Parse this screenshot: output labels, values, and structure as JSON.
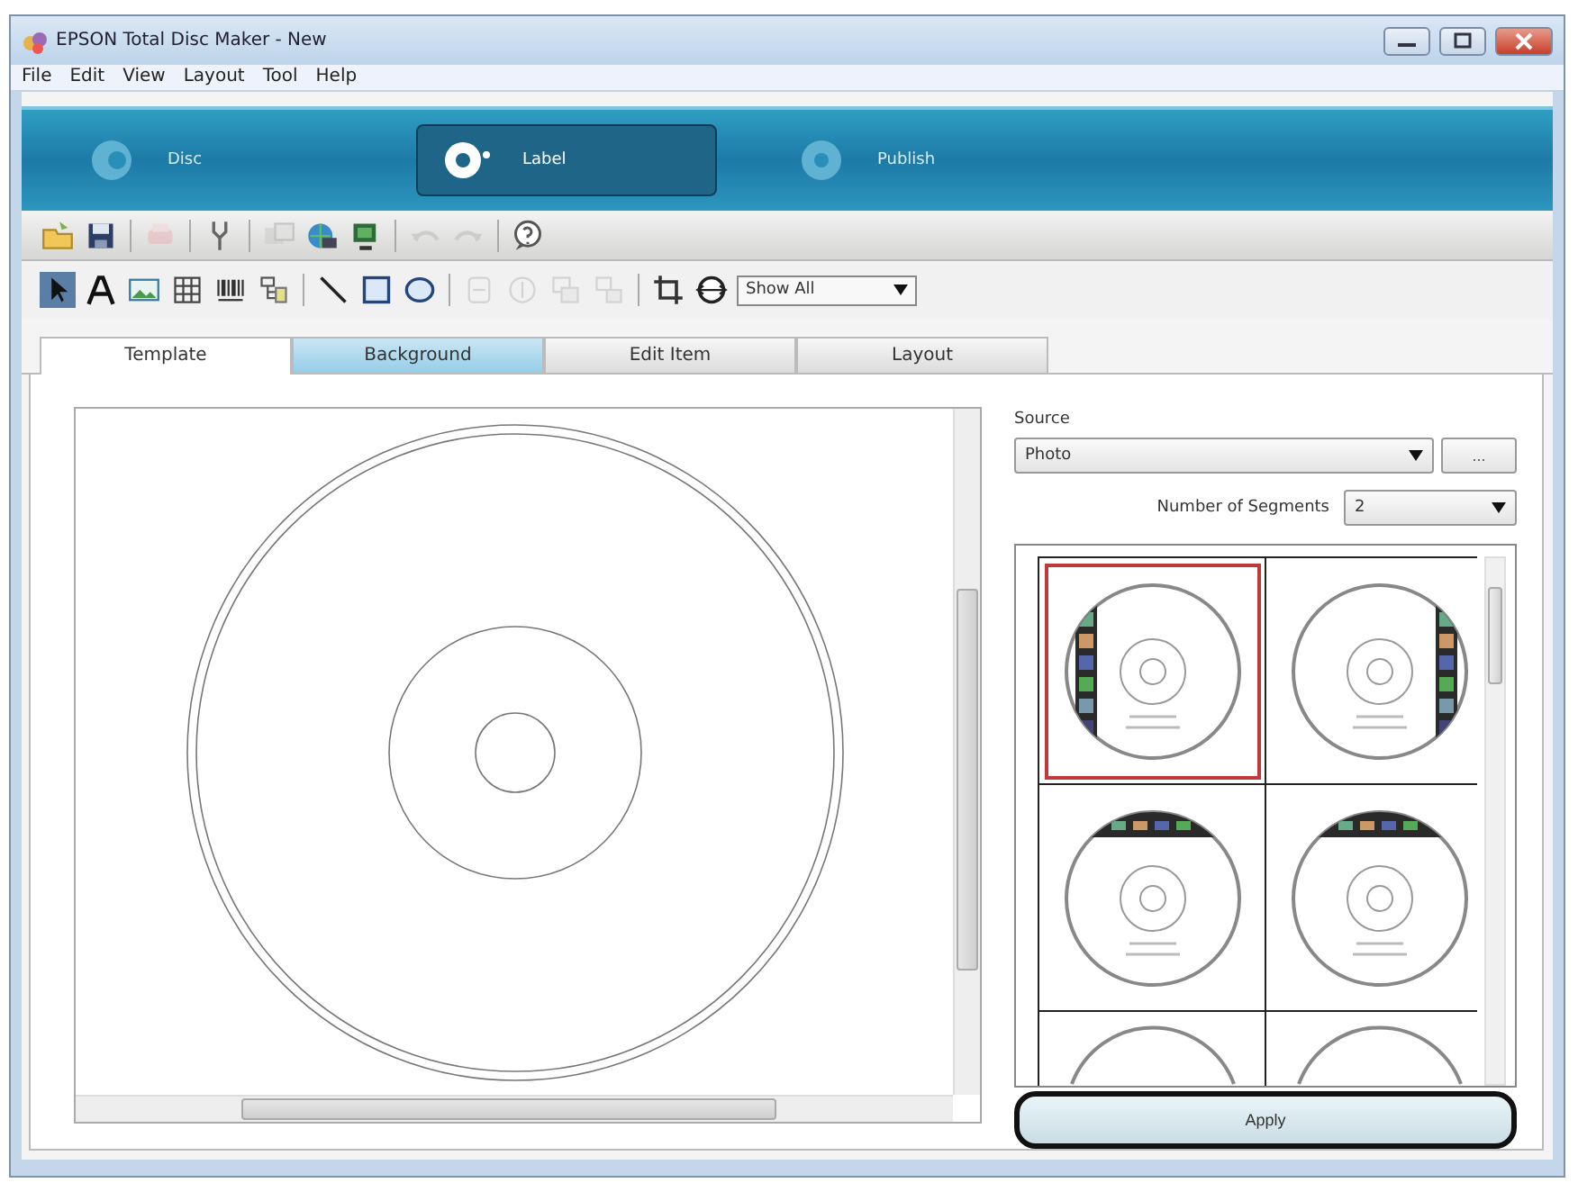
{
  "window": {
    "title": "EPSON Total Disc Maker - New"
  },
  "menu": [
    "File",
    "Edit",
    "View",
    "Layout",
    "Tool",
    "Help"
  ],
  "modes": [
    {
      "kind": "disc",
      "label": "Disc",
      "selected": false
    },
    {
      "kind": "label",
      "label": "Label",
      "selected": true
    },
    {
      "kind": "publish",
      "label": "Publish",
      "selected": false
    }
  ],
  "toolbar": [
    {
      "kind": "open",
      "disabled": false
    },
    {
      "kind": "save",
      "disabled": false
    },
    {
      "kind": "separator"
    },
    {
      "kind": "print",
      "disabled": true
    },
    {
      "kind": "separator"
    },
    {
      "kind": "tool",
      "disabled": false
    },
    {
      "kind": "separator"
    },
    {
      "kind": "photos",
      "disabled": true
    },
    {
      "kind": "web",
      "disabled": false
    },
    {
      "kind": "monitor",
      "disabled": false
    },
    {
      "kind": "separator"
    },
    {
      "kind": "undo",
      "disabled": true
    },
    {
      "kind": "redo",
      "disabled": true
    },
    {
      "kind": "separator"
    },
    {
      "kind": "help",
      "disabled": false
    }
  ],
  "draw_toolbar": [
    {
      "kind": "pointer",
      "disabled": false,
      "selected": true
    },
    {
      "kind": "text",
      "disabled": false,
      "selected": false
    },
    {
      "kind": "image",
      "disabled": false,
      "selected": false
    },
    {
      "kind": "table",
      "disabled": false,
      "selected": false
    },
    {
      "kind": "barcode",
      "disabled": false,
      "selected": false
    },
    {
      "kind": "tree",
      "disabled": false,
      "selected": false
    },
    {
      "kind": "separator"
    },
    {
      "kind": "line",
      "disabled": false,
      "selected": false
    },
    {
      "kind": "rect",
      "disabled": false,
      "selected": false
    },
    {
      "kind": "ellipse",
      "disabled": false,
      "selected": false
    },
    {
      "kind": "separator"
    },
    {
      "kind": "front",
      "disabled": true,
      "selected": false
    },
    {
      "kind": "back",
      "disabled": true,
      "selected": false
    },
    {
      "kind": "group",
      "disabled": true,
      "selected": false
    },
    {
      "kind": "ungroup",
      "disabled": true,
      "selected": false
    },
    {
      "kind": "separator"
    },
    {
      "kind": "crop",
      "disabled": false,
      "selected": false
    },
    {
      "kind": "fit",
      "disabled": false,
      "selected": false
    }
  ],
  "view_filter": {
    "value": "Show All"
  },
  "tabs": [
    {
      "label": "Template",
      "selected": true,
      "hover": false
    },
    {
      "label": "Background",
      "selected": false,
      "hover": true
    },
    {
      "label": "Edit Item",
      "selected": false,
      "hover": false
    },
    {
      "label": "Layout",
      "selected": false,
      "hover": false
    }
  ],
  "source": {
    "label": "Source",
    "value": "Photo",
    "browse_button": "..."
  },
  "segments": {
    "label": "Number of Segments",
    "value": "2"
  },
  "templates": [
    {
      "kind": "left-strip",
      "selected": true
    },
    {
      "kind": "right-strip",
      "selected": false
    },
    {
      "kind": "top-strip",
      "selected": false
    },
    {
      "kind": "top-strip",
      "selected": false
    },
    {
      "kind": "partial",
      "selected": false
    },
    {
      "kind": "partial",
      "selected": false
    }
  ],
  "apply_button": "Apply"
}
